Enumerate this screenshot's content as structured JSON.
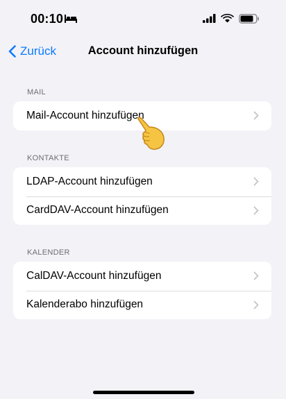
{
  "status_bar": {
    "time": "00:10",
    "icons": [
      "bed-icon",
      "signal-icon",
      "wifi-icon",
      "battery-icon"
    ]
  },
  "nav": {
    "back_label": "Zurück",
    "title": "Account hinzufügen"
  },
  "sections": [
    {
      "header": "MAIL",
      "rows": [
        "Mail-Account hinzufügen"
      ]
    },
    {
      "header": "KONTAKTE",
      "rows": [
        "LDAP-Account hinzufügen",
        "CardDAV-Account hinzufügen"
      ]
    },
    {
      "header": "KALENDER",
      "rows": [
        "CalDAV-Account hinzufügen",
        "Kalenderabo hinzufügen"
      ]
    }
  ],
  "colors": {
    "accent": "#0a7aff",
    "background": "#f2f2f7",
    "cell": "#ffffff",
    "section_header": "#6d6d72",
    "chevron": "#c4c4c7"
  }
}
